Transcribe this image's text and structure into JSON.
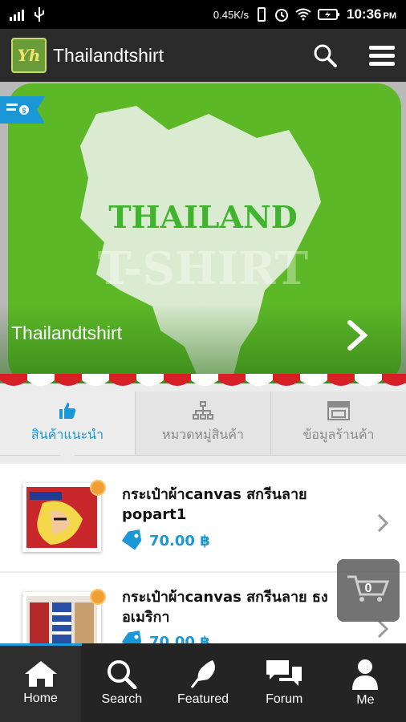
{
  "status_bar": {
    "speed": "0.45K/s",
    "time": "10:36",
    "ampm": "PM"
  },
  "app_bar": {
    "logo_text": "Yh",
    "title": "Thailandtshirt"
  },
  "banner": {
    "line1": "THAILAND",
    "line2": "T-SHIRT",
    "caption": "Thailandtshirt"
  },
  "tabs": [
    {
      "label": "สินค้าแนะนำ",
      "active": true
    },
    {
      "label": "หมวดหมู่สินค้า",
      "active": false
    },
    {
      "label": "ข้อมูลร้านค้า",
      "active": false
    }
  ],
  "products": [
    {
      "title": "กระเป๋าผ้าcanvas สกรีนลาย popart1",
      "price": "70.00 ฿"
    },
    {
      "title": "กระเป๋าผ้าcanvas สกรีนลาย ธง อเมริกา",
      "price": "70.00 ฿"
    }
  ],
  "cart": {
    "count": "0"
  },
  "bottom_nav": [
    {
      "label": "Home"
    },
    {
      "label": "Search"
    },
    {
      "label": "Featured"
    },
    {
      "label": "Forum"
    },
    {
      "label": "Me"
    }
  ],
  "colors": {
    "accent": "#1a97d6",
    "appbar": "#2b2b2b",
    "banner_green": "#5fb82a"
  }
}
